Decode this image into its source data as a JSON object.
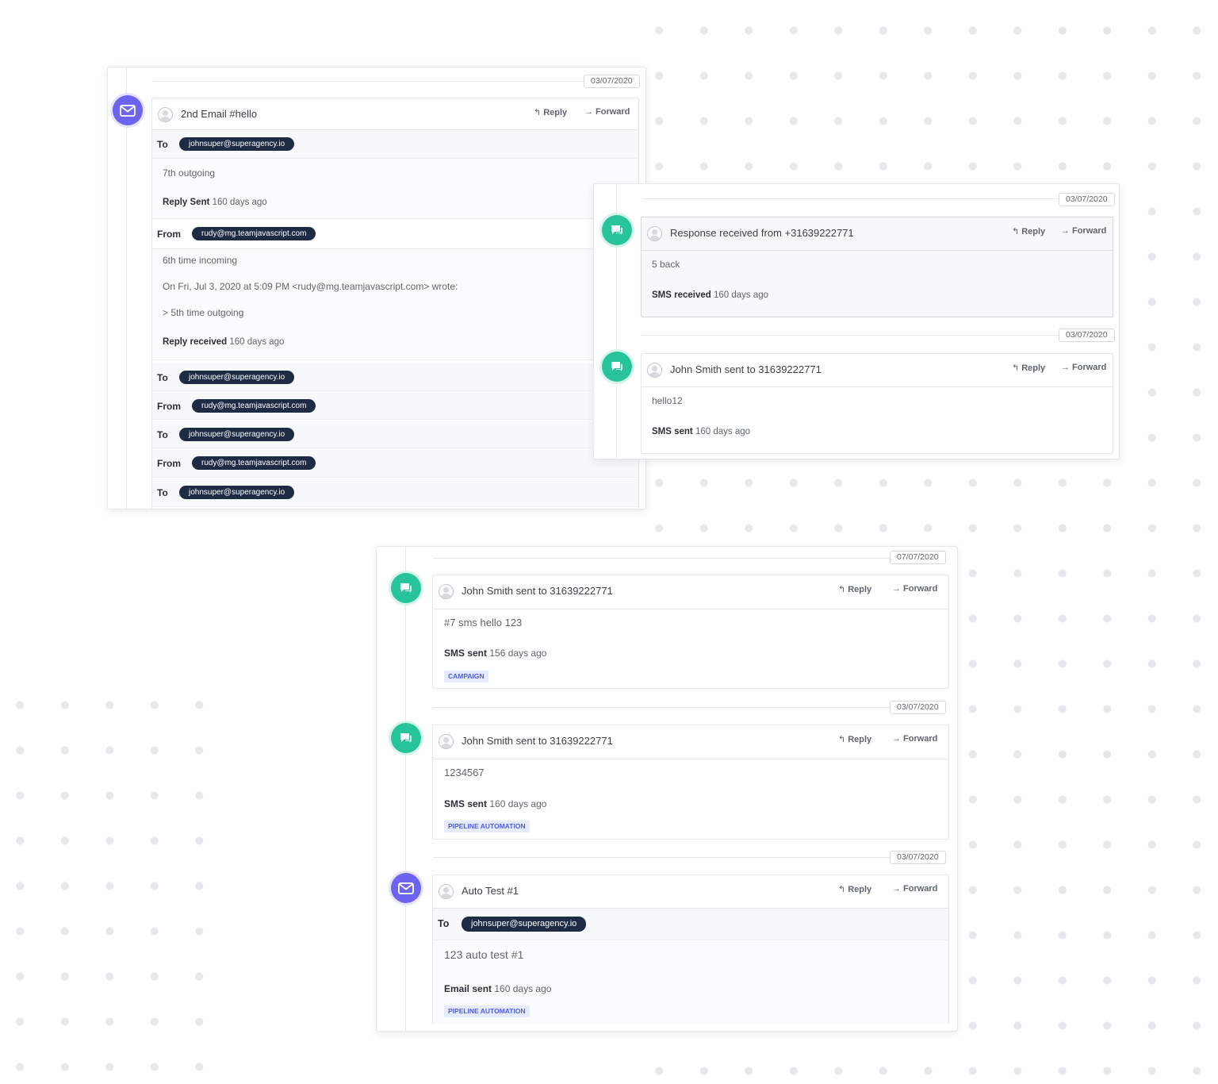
{
  "actions": {
    "reply": "Reply",
    "forward": "Forward"
  },
  "colors": {
    "email_accent": "#6c63ee",
    "sms_accent": "#27c49c",
    "pill_bg": "#1e2b45",
    "tag_bg": "#e6ebff",
    "tag_text": "#4d5de3"
  },
  "icons": {
    "email": "envelope-icon",
    "sms": "chat-bubble-icon",
    "user": "user-avatar-icon",
    "reply": "reply-arrow-icon",
    "forward": "forward-arrow-icon"
  },
  "panel_email": {
    "date": "03/07/2020",
    "subject": "2nd Email #hello",
    "to_label": "To",
    "from_label": "From",
    "to_email": "johnsuper@superagency.io",
    "from_email": "rudy@mg.teamjavascript.com",
    "body1": "7th outgoing",
    "status1_label": "Reply Sent",
    "status1_time": "160 days ago",
    "body2_line1": "6th time incoming",
    "body2_line2": "On Fri, Jul 3, 2020 at 5:09 PM <rudy@mg.teamjavascript.com> wrote:",
    "body2_line3": "> 5th time outgoing",
    "status2_label": "Reply received",
    "status2_time": "160 days ago"
  },
  "panel_sms_top": {
    "items": [
      {
        "date": "03/07/2020",
        "subject": "Response received from +31639222771",
        "body": "5 back",
        "status_label": "SMS received",
        "status_time": "160 days ago"
      },
      {
        "date": "03/07/2020",
        "subject": "John Smith sent to 31639222771",
        "body": "hello12",
        "status_label": "SMS sent",
        "status_time": "160 days ago"
      }
    ]
  },
  "panel_bottom": {
    "items": [
      {
        "date": "07/07/2020",
        "subject": "John Smith sent to 31639222771",
        "body": "#7 sms hello 123",
        "status_label": "SMS sent",
        "status_time": "156 days ago",
        "tag": "CAMPAIGN"
      },
      {
        "date": "03/07/2020",
        "subject": "John Smith sent to 31639222771",
        "body": "1234567",
        "status_label": "SMS sent",
        "status_time": "160 days ago",
        "tag": "PIPELINE AUTOMATION"
      },
      {
        "date": "03/07/2020",
        "subject": "Auto Test #1",
        "to_label": "To",
        "to_email": "johnsuper@superagency.io",
        "body": "123 auto test #1",
        "status_label": "Email sent",
        "status_time": "160 days ago",
        "tag": "PIPELINE AUTOMATION"
      }
    ]
  }
}
